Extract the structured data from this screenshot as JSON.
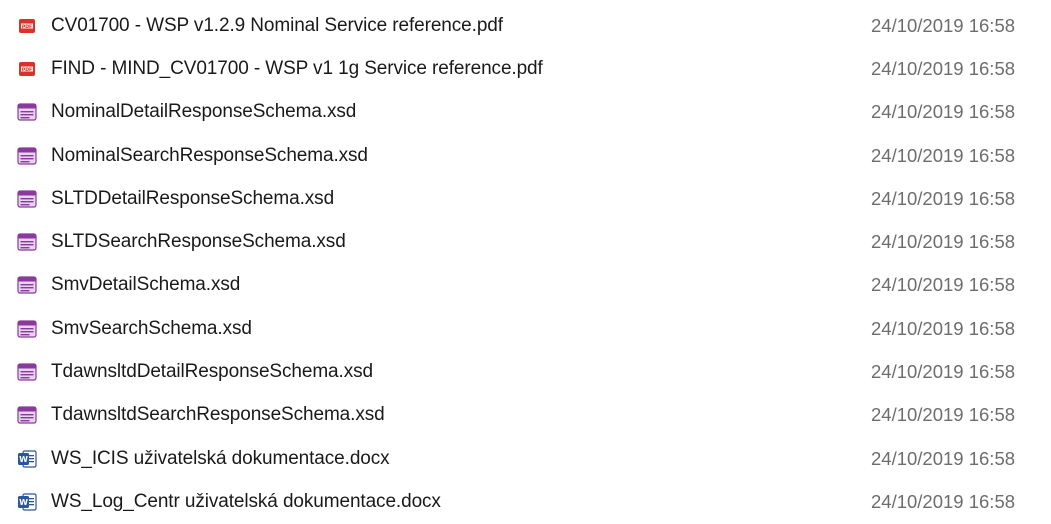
{
  "files": [
    {
      "name": "CV01700 - WSP v1.2.9 Nominal Service reference.pdf",
      "icon": "pdf-icon",
      "modified": "24/10/2019 16:58"
    },
    {
      "name": "FIND - MIND_CV01700 - WSP v1 1g Service reference.pdf",
      "icon": "pdf-icon",
      "modified": "24/10/2019 16:58"
    },
    {
      "name": "NominalDetailResponseSchema.xsd",
      "icon": "xsd-file-icon",
      "modified": "24/10/2019 16:58"
    },
    {
      "name": "NominalSearchResponseSchema.xsd",
      "icon": "xsd-file-icon",
      "modified": "24/10/2019 16:58"
    },
    {
      "name": "SLTDDetailResponseSchema.xsd",
      "icon": "xsd-file-icon",
      "modified": "24/10/2019 16:58"
    },
    {
      "name": "SLTDSearchResponseSchema.xsd",
      "icon": "xsd-file-icon",
      "modified": "24/10/2019 16:58"
    },
    {
      "name": "SmvDetailSchema.xsd",
      "icon": "xsd-file-icon",
      "modified": "24/10/2019 16:58"
    },
    {
      "name": "SmvSearchSchema.xsd",
      "icon": "xsd-file-icon",
      "modified": "24/10/2019 16:58"
    },
    {
      "name": "TdawnsltdDetailResponseSchema.xsd",
      "icon": "xsd-file-icon",
      "modified": "24/10/2019 16:58"
    },
    {
      "name": "TdawnsltdSearchResponseSchema.xsd",
      "icon": "xsd-file-icon",
      "modified": "24/10/2019 16:58"
    },
    {
      "name": "WS_ICIS uživatelská dokumentace.docx",
      "icon": "word-doc-icon",
      "modified": "24/10/2019 16:58"
    },
    {
      "name": "WS_Log_Centr uživatelská dokumentace.docx",
      "icon": "word-doc-icon",
      "modified": "24/10/2019 16:58"
    }
  ],
  "colors": {
    "pdf_icon": "#d9322b",
    "xsd_icon": "#8a3a9c",
    "word_icon": "#2b579a",
    "date_text": "#6d6d6d",
    "name_text": "#1a1a1a"
  }
}
